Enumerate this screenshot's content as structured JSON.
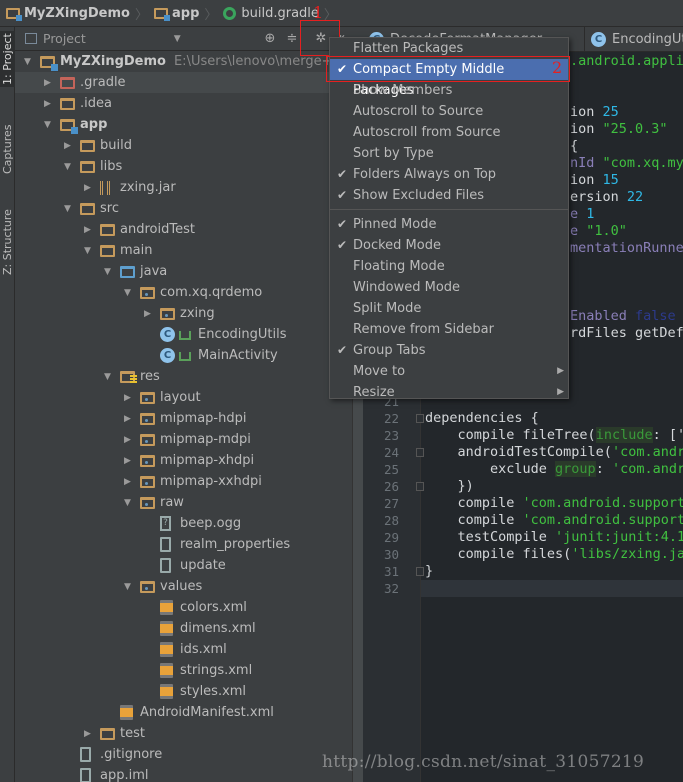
{
  "breadcrumbs": [
    {
      "label": "MyZXingDemo",
      "icon": "module-folder-icon"
    },
    {
      "label": "app",
      "icon": "module-folder-icon"
    },
    {
      "label": "build.gradle",
      "icon": "gradle-icon"
    }
  ],
  "tool_strip": {
    "tabs": [
      {
        "label": "1: Project",
        "active": true
      },
      {
        "label": "Captures",
        "active": false
      },
      {
        "label": "Z: Structure",
        "active": false
      }
    ]
  },
  "project_panel": {
    "title": "Project",
    "toolbar_icons": [
      "scroll-from-source-icon",
      "collapse-all-icon",
      "gear-icon",
      "hide-icon"
    ]
  },
  "tree": [
    {
      "level": 0,
      "label": "MyZXingDemo",
      "path": "E:\\Users\\lenovo\\merge++++",
      "type": "mod",
      "expanded": true,
      "bold": true
    },
    {
      "level": 1,
      "label": ".gradle",
      "type": "red",
      "expanded": false,
      "selected": true
    },
    {
      "level": 1,
      "label": ".idea",
      "type": "folder",
      "expanded": false
    },
    {
      "level": 1,
      "label": "app",
      "type": "mod",
      "expanded": true,
      "bold": true
    },
    {
      "level": 2,
      "label": "build",
      "type": "folder",
      "expanded": false
    },
    {
      "level": 2,
      "label": "libs",
      "type": "folder",
      "expanded": true
    },
    {
      "level": 3,
      "label": "zxing.jar",
      "type": "jar",
      "expanded": false
    },
    {
      "level": 2,
      "label": "src",
      "type": "folder",
      "expanded": true
    },
    {
      "level": 3,
      "label": "androidTest",
      "type": "folder",
      "expanded": false
    },
    {
      "level": 3,
      "label": "main",
      "type": "folder",
      "expanded": true
    },
    {
      "level": 4,
      "label": "java",
      "type": "src",
      "expanded": true
    },
    {
      "level": 5,
      "label": "com.xq.qrdemo",
      "type": "pkg",
      "expanded": true
    },
    {
      "level": 6,
      "label": "zxing",
      "type": "pkg",
      "expanded": false
    },
    {
      "level": 6,
      "label": "EncodingUtils",
      "type": "class"
    },
    {
      "level": 6,
      "label": "MainActivity",
      "type": "class"
    },
    {
      "level": 4,
      "label": "res",
      "type": "res",
      "expanded": true
    },
    {
      "level": 5,
      "label": "layout",
      "type": "pkg",
      "expanded": false
    },
    {
      "level": 5,
      "label": "mipmap-hdpi",
      "type": "pkg",
      "expanded": false
    },
    {
      "level": 5,
      "label": "mipmap-mdpi",
      "type": "pkg",
      "expanded": false
    },
    {
      "level": 5,
      "label": "mipmap-xhdpi",
      "type": "pkg",
      "expanded": false
    },
    {
      "level": 5,
      "label": "mipmap-xxhdpi",
      "type": "pkg",
      "expanded": false
    },
    {
      "level": 5,
      "label": "raw",
      "type": "pkg",
      "expanded": true
    },
    {
      "level": 6,
      "label": "beep.ogg",
      "type": "unk"
    },
    {
      "level": 6,
      "label": "realm_properties",
      "type": "file"
    },
    {
      "level": 6,
      "label": "update",
      "type": "file"
    },
    {
      "level": 5,
      "label": "values",
      "type": "pkg",
      "expanded": true
    },
    {
      "level": 6,
      "label": "colors.xml",
      "type": "xml"
    },
    {
      "level": 6,
      "label": "dimens.xml",
      "type": "xml"
    },
    {
      "level": 6,
      "label": "ids.xml",
      "type": "xml"
    },
    {
      "level": 6,
      "label": "strings.xml",
      "type": "xml"
    },
    {
      "level": 6,
      "label": "styles.xml",
      "type": "xml"
    },
    {
      "level": 4,
      "label": "AndroidManifest.xml",
      "type": "xml"
    },
    {
      "level": 3,
      "label": "test",
      "type": "folder",
      "expanded": false
    },
    {
      "level": 2,
      "label": ".gitignore",
      "type": "file"
    },
    {
      "level": 2,
      "label": "app.iml",
      "type": "file"
    }
  ],
  "editor_tabs": [
    {
      "label": "DecodeFormatManager",
      "icon": "class-icon"
    },
    {
      "label": "EncodingUtils",
      "icon": "class-icon"
    }
  ],
  "code_fragments": [
    {
      "line": 1,
      "tokens": [
        [
          ".android.applic",
          "str"
        ]
      ]
    },
    {
      "line": 4,
      "tokens": [
        [
          "ion ",
          ""
        ],
        [
          "25",
          "num"
        ]
      ]
    },
    {
      "line": 5,
      "tokens": [
        [
          "ion ",
          ""
        ],
        [
          "\"25.0.3\"",
          "str"
        ]
      ]
    },
    {
      "line": 6,
      "tokens": [
        [
          "{",
          ""
        ]
      ]
    },
    {
      "line": 7,
      "tokens": [
        [
          "nId ",
          "prop"
        ],
        [
          "\"com.xq.my",
          "str"
        ]
      ]
    },
    {
      "line": 8,
      "tokens": [
        [
          "ion ",
          ""
        ],
        [
          "15",
          "num"
        ]
      ]
    },
    {
      "line": 9,
      "tokens": [
        [
          "ersion ",
          ""
        ],
        [
          "22",
          "num"
        ]
      ]
    },
    {
      "line": 10,
      "tokens": [
        [
          "e ",
          "prop"
        ],
        [
          "1",
          "num"
        ]
      ]
    },
    {
      "line": 11,
      "tokens": [
        [
          "e ",
          "prop"
        ],
        [
          "\"1.0\"",
          "str"
        ]
      ]
    },
    {
      "line": 12,
      "tokens": [
        [
          "mentationRunner",
          "prop"
        ]
      ]
    },
    {
      "line": 16,
      "tokens": [
        [
          "Enabled ",
          "prop"
        ],
        [
          "false",
          "kw"
        ]
      ]
    },
    {
      "line": 17,
      "tokens": [
        [
          "rdFiles getDefa",
          ""
        ]
      ]
    }
  ],
  "code_lines": [
    {
      "line": 21,
      "tokens": []
    },
    {
      "line": 22,
      "tokens": [
        [
          "dependencies {",
          ""
        ]
      ]
    },
    {
      "line": 23,
      "tokens": [
        [
          "    compile fileTree(",
          ""
        ],
        [
          "include",
          "named"
        ],
        [
          ": ['",
          ""
        ]
      ]
    },
    {
      "line": 24,
      "tokens": [
        [
          "    androidTestCompile(",
          ""
        ],
        [
          "'com.andro",
          "str"
        ]
      ]
    },
    {
      "line": 25,
      "tokens": [
        [
          "        exclude ",
          ""
        ],
        [
          "group",
          "named"
        ],
        [
          ": ",
          ""
        ],
        [
          "'com.andro",
          "str"
        ]
      ]
    },
    {
      "line": 26,
      "tokens": [
        [
          "    })",
          ""
        ]
      ]
    },
    {
      "line": 27,
      "tokens": [
        [
          "    compile ",
          ""
        ],
        [
          "'com.android.support",
          "str"
        ]
      ]
    },
    {
      "line": 28,
      "tokens": [
        [
          "    compile ",
          ""
        ],
        [
          "'com.android.support",
          "str"
        ]
      ]
    },
    {
      "line": 29,
      "tokens": [
        [
          "    testCompile ",
          ""
        ],
        [
          "'junit:junit:4.12",
          "str"
        ]
      ]
    },
    {
      "line": 30,
      "tokens": [
        [
          "    compile files(",
          ""
        ],
        [
          "'libs/zxing.jar",
          "str"
        ]
      ]
    },
    {
      "line": 31,
      "tokens": [
        [
          "}",
          ""
        ]
      ]
    },
    {
      "line": 32,
      "tokens": [],
      "current": true
    }
  ],
  "gear_menu": {
    "items": [
      {
        "label": "Flatten Packages",
        "checked": false
      },
      {
        "label": "Compact Empty Middle Packages",
        "checked": true,
        "highlighted": true
      },
      {
        "label": "Show Members",
        "checked": false
      },
      {
        "label": "Autoscroll to Source",
        "checked": false
      },
      {
        "label": "Autoscroll from Source",
        "checked": false
      },
      {
        "label": "Sort by Type",
        "checked": false
      },
      {
        "label": "Folders Always on Top",
        "checked": true
      },
      {
        "label": "Show Excluded Files",
        "checked": true,
        "separator_after": true
      },
      {
        "label": "Pinned Mode",
        "checked": true
      },
      {
        "label": "Docked Mode",
        "checked": true
      },
      {
        "label": "Floating Mode",
        "checked": false
      },
      {
        "label": "Windowed Mode",
        "checked": false
      },
      {
        "label": "Split Mode",
        "checked": false
      },
      {
        "label": "Remove from Sidebar",
        "checked": false
      },
      {
        "label": "Group Tabs",
        "checked": true
      },
      {
        "label": "Move to",
        "checked": false,
        "submenu": true
      },
      {
        "label": "Resize",
        "checked": false,
        "submenu": true
      }
    ]
  },
  "annotations": {
    "step1": "1",
    "step2": "2",
    "color": "#e52020"
  },
  "watermark": "http://blog.csdn.net/sinat_31057219",
  "colors": {
    "menu_highlight": "#4b6eaf",
    "panel_bg": "#3c3f41",
    "editor_bg": "#23272b",
    "string": "#40c040",
    "number": "#2fb8e6"
  }
}
